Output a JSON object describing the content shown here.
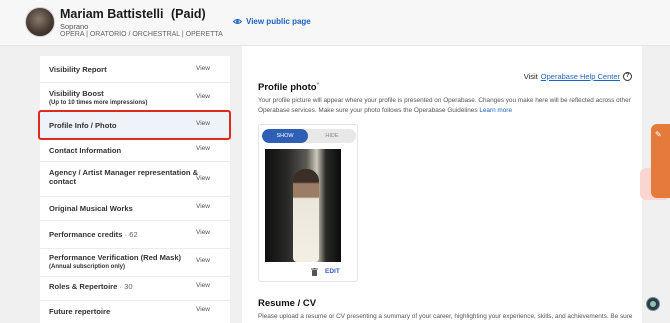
{
  "profile": {
    "name": "Mariam Battistelli",
    "plan": "(Paid)",
    "voice_type": "Soprano",
    "genres": "OPERA | ORATORIO / ORCHESTRAL | OPERETTA",
    "view_public": "View public page"
  },
  "sidebar": {
    "items": [
      {
        "label": "Visibility Report",
        "sub": "",
        "count": "",
        "view": "View"
      },
      {
        "label": "Visibility Boost",
        "sub": "(Up to 10 times more impressions)",
        "count": "",
        "view": "View"
      },
      {
        "label": "Profile Info / Photo",
        "sub": "",
        "count": "",
        "view": "View"
      },
      {
        "label": "Contact Information",
        "sub": "",
        "count": "",
        "view": "View"
      },
      {
        "label": "Agency / Artist Manager representation &",
        "sub": "contact",
        "count": "",
        "view": "View"
      },
      {
        "label": "Original Musical Works",
        "sub": "",
        "count": "",
        "view": "View"
      },
      {
        "label": "Performance credits",
        "sub": "",
        "count": "· 62",
        "view": "View"
      },
      {
        "label": "Performance Verification (Red Mask)",
        "sub": "(Annual subscription only)",
        "count": "",
        "view": "View"
      },
      {
        "label": "Roles & Repertoire",
        "sub": "",
        "count": "· 30",
        "view": "View"
      },
      {
        "label": "Future repertoire",
        "sub": "",
        "count": "",
        "view": "View"
      }
    ]
  },
  "main": {
    "help_prefix": "Visit",
    "help_link": "Operabase Help Center",
    "profile_photo": {
      "title": "Profile photo",
      "required_mark": "*",
      "desc": "Your profile picture will appear where your profile is presented on Operabase. Changes you make here will be reflected across other Operabase services. Make sure your photo follows the Operabase Guidelines",
      "learn_more": "Learn more",
      "toggle_show": "SHOW",
      "toggle_hide": "HIDE",
      "edit": "EDIT"
    },
    "resume": {
      "title": "Resume / CV",
      "desc": "Please upload a resume or CV presenting a summary of your career, highlighting your experience, skills, and achievements. Be sure to"
    }
  },
  "icons": {
    "view_public": "eye-icon",
    "help": "question-circle-icon",
    "delete": "trash-icon",
    "feedback": "chat-icon"
  },
  "colors": {
    "accent": "#2f5fb5",
    "link": "#1e62c6",
    "highlight": "#e02a1f",
    "feedback": "#e57b3a"
  }
}
